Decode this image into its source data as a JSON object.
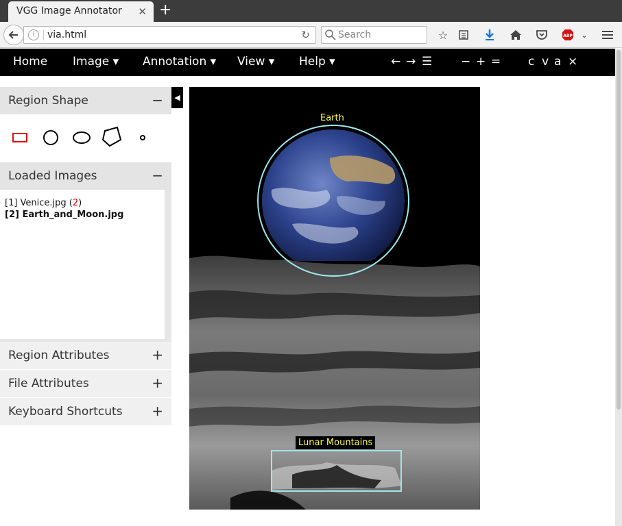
{
  "browser": {
    "tab_title": "VGG Image Annotator",
    "url": "via.html",
    "search_placeholder": "Search"
  },
  "menu": {
    "items": [
      "Home",
      "Image ▾",
      "Annotation ▾",
      "View ▾",
      "Help ▾"
    ],
    "tools": [
      "←",
      "→",
      "☰",
      "−",
      "+",
      "=",
      "c",
      "v",
      "a",
      "×"
    ]
  },
  "left_panel": {
    "region_shape": {
      "title": "Region Shape",
      "toggle": "−"
    },
    "shapes": [
      "rectangle",
      "circle",
      "ellipse",
      "polygon",
      "point"
    ],
    "loaded_images": {
      "title": "Loaded Images",
      "toggle": "−",
      "items": [
        {
          "prefix": "[1] Venice.jpg (",
          "count": "2",
          "suffix": ")"
        },
        {
          "label": "[2] Earth_and_Moon.jpg"
        }
      ]
    },
    "region_attributes": {
      "title": "Region Attributes",
      "toggle": "+"
    },
    "file_attributes": {
      "title": "File Attributes",
      "toggle": "+"
    },
    "keyboard_shortcuts": {
      "title": "Keyboard Shortcuts",
      "toggle": "+"
    }
  },
  "canvas": {
    "regions": [
      {
        "label": "Earth",
        "shape": "circle"
      },
      {
        "label": "Lunar Mountains",
        "shape": "rectangle"
      }
    ]
  },
  "colors": {
    "region_stroke": "#9fe8ef",
    "label_text": "#ffff3b",
    "selected_shape": "#e01010",
    "menubar_bg": "#000000"
  }
}
